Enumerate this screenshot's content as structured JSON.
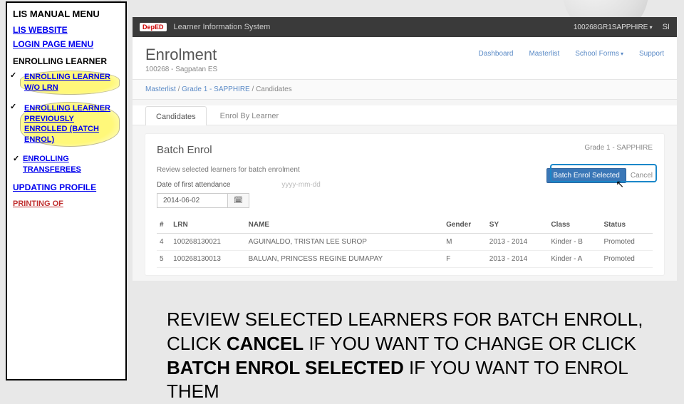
{
  "sidebar": {
    "title": "LIS MANUAL MENU",
    "links": {
      "website": "LIS WEBSITE",
      "login": "LOGIN PAGE MENU"
    },
    "section": "ENROLLING LEARNER",
    "items": [
      "ENROLLING LEARNER W/O LRN",
      "ENROLLING LEARNER PREVIOUSLY ENROLLED (BATCH ENROL)",
      "ENROLLING TRANSFEREES"
    ],
    "updating": "UPDATING PROFILE",
    "cutoff": "PRINTING OF"
  },
  "topbar": {
    "logo": "DepED",
    "title": "Learner Information System",
    "user": "100268GR1SAPPHIRE",
    "s_label": "SI"
  },
  "subhead": {
    "title": "Enrolment",
    "subtitle": "100268 - Sagpatan ES",
    "nav": [
      "Dashboard",
      "Masterlist",
      "School Forms",
      "Support"
    ]
  },
  "crumbs": [
    "Masterlist",
    "Grade 1 - SAPPHIRE",
    "Candidates"
  ],
  "tabs": [
    "Candidates",
    "Enrol By Learner"
  ],
  "panel": {
    "title": "Batch Enrol",
    "tag": "Grade 1 - SAPPHIRE",
    "review": "Review selected learners for batch enrolment",
    "primary": "Batch Enrol Selected",
    "cancel": "Cancel",
    "date_label": "Date of first attendance",
    "date_ph": "yyyy-mm-dd",
    "date_val": "2014-06-02",
    "cal_icon": "🗓"
  },
  "table": {
    "headers": [
      "#",
      "LRN",
      "NAME",
      "Gender",
      "SY",
      "Class",
      "Status"
    ],
    "rows": [
      [
        "4",
        "100268130021",
        "AGUINALDO, TRISTAN LEE SUROP",
        "M",
        "2013 - 2014",
        "Kinder - B",
        "Promoted"
      ],
      [
        "5",
        "100268130013",
        "BALUAN, PRINCESS REGINE DUMAPAY",
        "F",
        "2013 - 2014",
        "Kinder - A",
        "Promoted"
      ]
    ]
  },
  "instruction": {
    "t1": "REVIEW SELECTED LEARNERS FOR BATCH ENROLL, CLICK ",
    "b1": "CANCEL",
    "t2": " IF YOU WANT TO CHANGE OR CLICK ",
    "b2": "BATCH ENROL SELECTED",
    "t3": " IF YOU WANT TO ENROL THEM"
  }
}
